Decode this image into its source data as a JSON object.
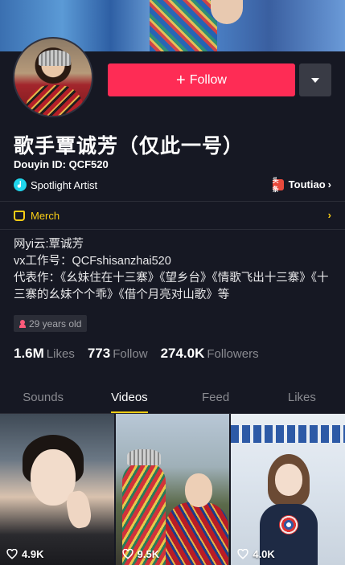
{
  "profile": {
    "name": "歌手覃诚芳（仅此一号）",
    "douyin_id": "Douyin ID: QCF520",
    "badge": "Spotlight Artist",
    "toutiao_label": "Toutiao",
    "toutiao_icon_text": "头条",
    "follow_label": "Follow",
    "merch_label": "Merch",
    "bio": [
      "网yi云:覃诚芳",
      "vx工作号：QCFshisanzhai520",
      "代表作：《幺妹住在十三寨》《望乡台》《情歌飞出十三寨》《十三寨的幺妹个个乖》《借个月亮对山歌》等"
    ],
    "age": "29 years old"
  },
  "stats": {
    "likes_value": "1.6M",
    "likes_label": "Likes",
    "follow_value": "773",
    "follow_label": "Follow",
    "followers_value": "274.0K",
    "followers_label": "Followers"
  },
  "tabs": [
    "Sounds",
    "Videos",
    "Feed",
    "Likes"
  ],
  "active_tab": "Videos",
  "videos": [
    {
      "likes": "4.9K"
    },
    {
      "likes": "9.5K"
    },
    {
      "likes": "4.0K"
    }
  ],
  "colors": {
    "background": "#161823",
    "follow_button": "#fe2c55",
    "accent_yellow": "#face15",
    "spotlight": "#20d5ec"
  },
  "icons": [
    "plus-icon",
    "dropdown-caret-icon",
    "spotlight-icon",
    "toutiao-icon",
    "merch-icon",
    "chevron-right-icon",
    "age-icon",
    "heart-icon"
  ]
}
